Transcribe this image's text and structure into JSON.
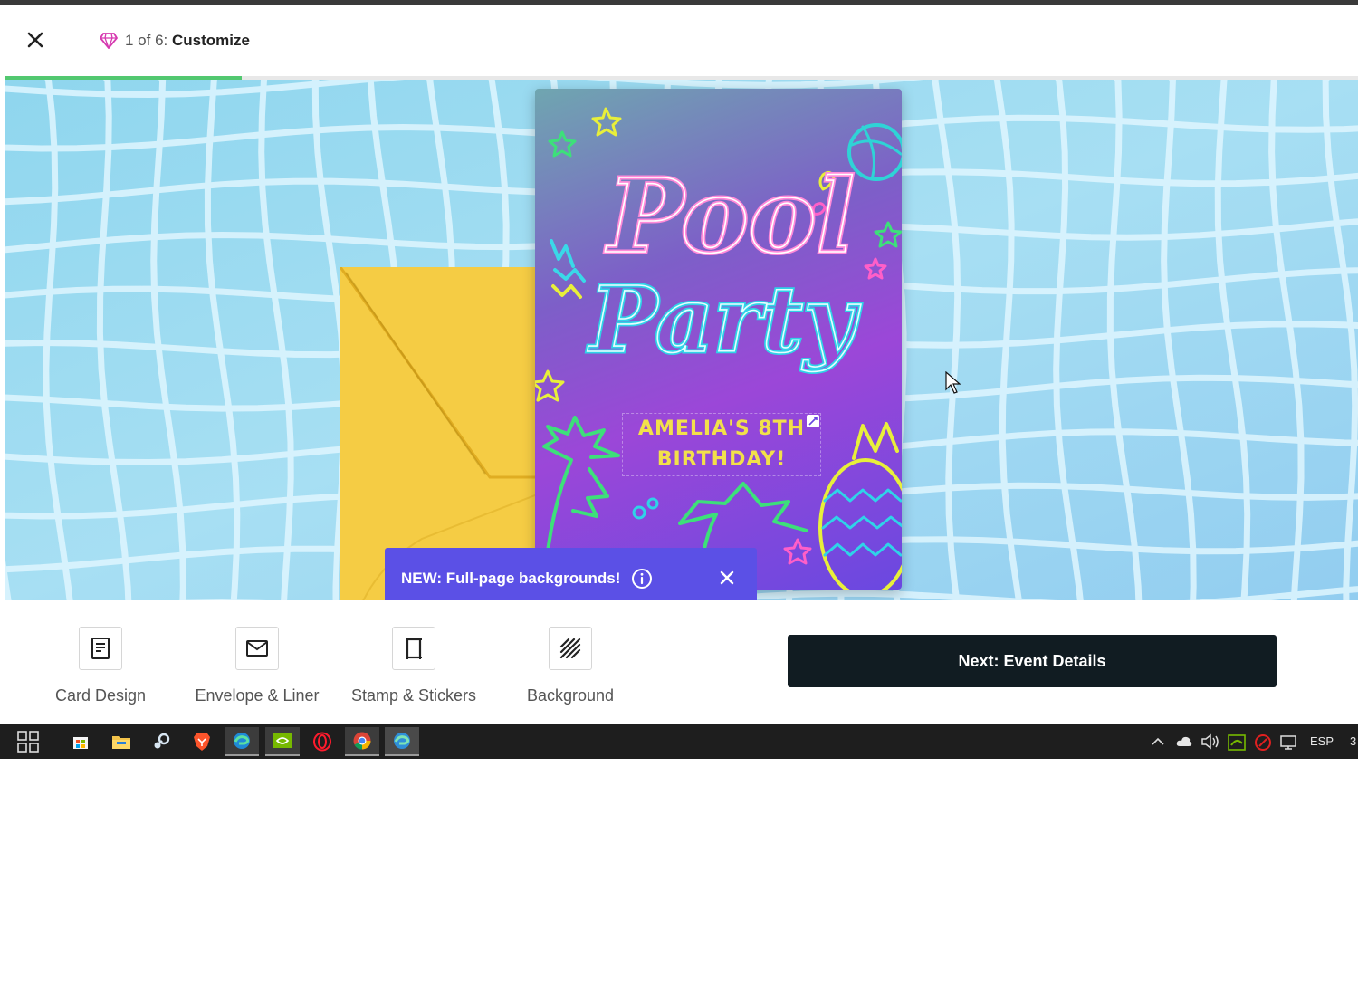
{
  "header": {
    "step_count": "1 of 6:",
    "step_name": "Customize",
    "close_icon": "close-icon",
    "gem_icon": "gem-icon"
  },
  "progress": {
    "fraction": 0.175,
    "color": "#52c870"
  },
  "card": {
    "title_line1": "Pool",
    "title_line2": "Party",
    "text_line1": "AMELIA'S 8TH",
    "text_line2": "BIRTHDAY!"
  },
  "tooltip": {
    "text": "NEW: Full-page backgrounds!",
    "info_icon": "info-icon",
    "close_icon": "close-icon",
    "color": "#5b50e6"
  },
  "toolbar": {
    "tools": [
      {
        "label": "Card Design",
        "icon": "card-design-icon"
      },
      {
        "label": "Envelope & Liner",
        "icon": "envelope-icon"
      },
      {
        "label": "Stamp & Stickers",
        "icon": "stamp-icon"
      },
      {
        "label": "Background",
        "icon": "background-icon"
      }
    ],
    "next_label": "Next: Event Details"
  },
  "taskbar": {
    "icons": [
      "start-icon",
      "store-icon",
      "file-explorer-icon",
      "steam-icon",
      "brave-icon",
      "edge-icon",
      "nvidia-icon",
      "opera-icon",
      "chrome-icon",
      "edge-dev-icon"
    ],
    "tray_icons": [
      "chevron-up-icon",
      "cloud-icon",
      "volume-icon",
      "nvidia-tray-icon",
      "antivirus-icon",
      "network-icon"
    ],
    "language": "ESP",
    "clock_fragment": "3"
  }
}
